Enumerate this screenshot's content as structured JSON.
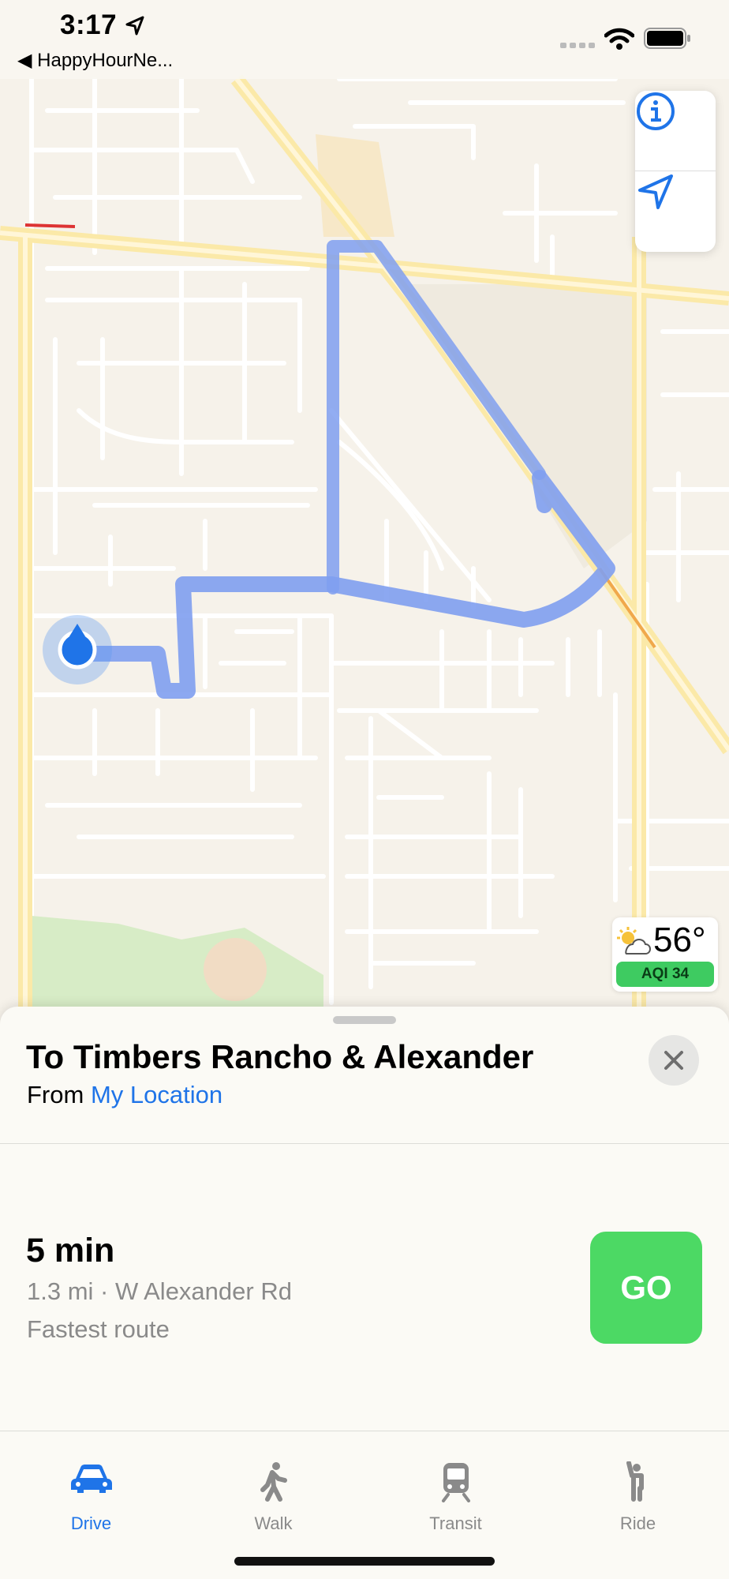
{
  "status_bar": {
    "time": "3:17",
    "back_app": "HappyHourNe..."
  },
  "map": {
    "weather_temp": "56°",
    "aqi": "AQI 34",
    "info_icon": "info-circle-icon",
    "locate_icon": "location-arrow-icon"
  },
  "directions": {
    "title": "To Timbers Rancho & Alexander",
    "from_label": "From",
    "from_location": "My Location",
    "route_time": "5 min",
    "route_detail": "1.3 mi · W Alexander Rd",
    "route_note": "Fastest route",
    "go_label": "GO"
  },
  "tabs": [
    {
      "label": "Drive",
      "active": true,
      "icon": "car-icon"
    },
    {
      "label": "Walk",
      "active": false,
      "icon": "walk-icon"
    },
    {
      "label": "Transit",
      "active": false,
      "icon": "train-icon"
    },
    {
      "label": "Ride",
      "active": false,
      "icon": "ride-icon"
    }
  ],
  "colors": {
    "route": "#7f9ff0",
    "accent": "#1f74e8",
    "go": "#4cd964"
  }
}
